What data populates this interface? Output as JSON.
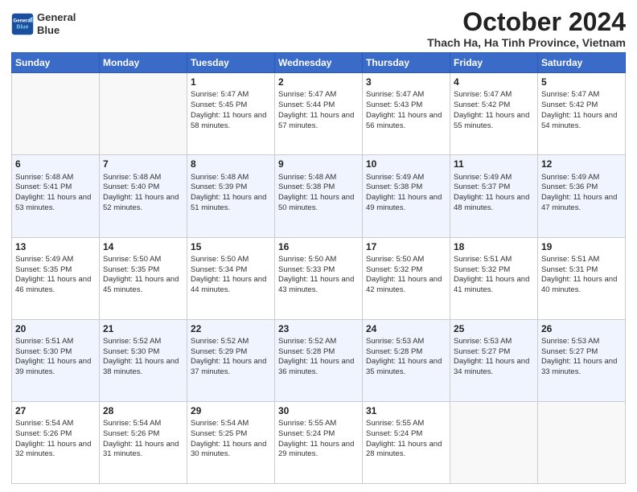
{
  "header": {
    "logo_line1": "General",
    "logo_line2": "Blue",
    "month": "October 2024",
    "location": "Thach Ha, Ha Tinh Province, Vietnam"
  },
  "days_of_week": [
    "Sunday",
    "Monday",
    "Tuesday",
    "Wednesday",
    "Thursday",
    "Friday",
    "Saturday"
  ],
  "weeks": [
    [
      {
        "day": "",
        "info": ""
      },
      {
        "day": "",
        "info": ""
      },
      {
        "day": "1",
        "info": "Sunrise: 5:47 AM\nSunset: 5:45 PM\nDaylight: 11 hours and 58 minutes."
      },
      {
        "day": "2",
        "info": "Sunrise: 5:47 AM\nSunset: 5:44 PM\nDaylight: 11 hours and 57 minutes."
      },
      {
        "day": "3",
        "info": "Sunrise: 5:47 AM\nSunset: 5:43 PM\nDaylight: 11 hours and 56 minutes."
      },
      {
        "day": "4",
        "info": "Sunrise: 5:47 AM\nSunset: 5:42 PM\nDaylight: 11 hours and 55 minutes."
      },
      {
        "day": "5",
        "info": "Sunrise: 5:47 AM\nSunset: 5:42 PM\nDaylight: 11 hours and 54 minutes."
      }
    ],
    [
      {
        "day": "6",
        "info": "Sunrise: 5:48 AM\nSunset: 5:41 PM\nDaylight: 11 hours and 53 minutes."
      },
      {
        "day": "7",
        "info": "Sunrise: 5:48 AM\nSunset: 5:40 PM\nDaylight: 11 hours and 52 minutes."
      },
      {
        "day": "8",
        "info": "Sunrise: 5:48 AM\nSunset: 5:39 PM\nDaylight: 11 hours and 51 minutes."
      },
      {
        "day": "9",
        "info": "Sunrise: 5:48 AM\nSunset: 5:38 PM\nDaylight: 11 hours and 50 minutes."
      },
      {
        "day": "10",
        "info": "Sunrise: 5:49 AM\nSunset: 5:38 PM\nDaylight: 11 hours and 49 minutes."
      },
      {
        "day": "11",
        "info": "Sunrise: 5:49 AM\nSunset: 5:37 PM\nDaylight: 11 hours and 48 minutes."
      },
      {
        "day": "12",
        "info": "Sunrise: 5:49 AM\nSunset: 5:36 PM\nDaylight: 11 hours and 47 minutes."
      }
    ],
    [
      {
        "day": "13",
        "info": "Sunrise: 5:49 AM\nSunset: 5:35 PM\nDaylight: 11 hours and 46 minutes."
      },
      {
        "day": "14",
        "info": "Sunrise: 5:50 AM\nSunset: 5:35 PM\nDaylight: 11 hours and 45 minutes."
      },
      {
        "day": "15",
        "info": "Sunrise: 5:50 AM\nSunset: 5:34 PM\nDaylight: 11 hours and 44 minutes."
      },
      {
        "day": "16",
        "info": "Sunrise: 5:50 AM\nSunset: 5:33 PM\nDaylight: 11 hours and 43 minutes."
      },
      {
        "day": "17",
        "info": "Sunrise: 5:50 AM\nSunset: 5:32 PM\nDaylight: 11 hours and 42 minutes."
      },
      {
        "day": "18",
        "info": "Sunrise: 5:51 AM\nSunset: 5:32 PM\nDaylight: 11 hours and 41 minutes."
      },
      {
        "day": "19",
        "info": "Sunrise: 5:51 AM\nSunset: 5:31 PM\nDaylight: 11 hours and 40 minutes."
      }
    ],
    [
      {
        "day": "20",
        "info": "Sunrise: 5:51 AM\nSunset: 5:30 PM\nDaylight: 11 hours and 39 minutes."
      },
      {
        "day": "21",
        "info": "Sunrise: 5:52 AM\nSunset: 5:30 PM\nDaylight: 11 hours and 38 minutes."
      },
      {
        "day": "22",
        "info": "Sunrise: 5:52 AM\nSunset: 5:29 PM\nDaylight: 11 hours and 37 minutes."
      },
      {
        "day": "23",
        "info": "Sunrise: 5:52 AM\nSunset: 5:28 PM\nDaylight: 11 hours and 36 minutes."
      },
      {
        "day": "24",
        "info": "Sunrise: 5:53 AM\nSunset: 5:28 PM\nDaylight: 11 hours and 35 minutes."
      },
      {
        "day": "25",
        "info": "Sunrise: 5:53 AM\nSunset: 5:27 PM\nDaylight: 11 hours and 34 minutes."
      },
      {
        "day": "26",
        "info": "Sunrise: 5:53 AM\nSunset: 5:27 PM\nDaylight: 11 hours and 33 minutes."
      }
    ],
    [
      {
        "day": "27",
        "info": "Sunrise: 5:54 AM\nSunset: 5:26 PM\nDaylight: 11 hours and 32 minutes."
      },
      {
        "day": "28",
        "info": "Sunrise: 5:54 AM\nSunset: 5:26 PM\nDaylight: 11 hours and 31 minutes."
      },
      {
        "day": "29",
        "info": "Sunrise: 5:54 AM\nSunset: 5:25 PM\nDaylight: 11 hours and 30 minutes."
      },
      {
        "day": "30",
        "info": "Sunrise: 5:55 AM\nSunset: 5:24 PM\nDaylight: 11 hours and 29 minutes."
      },
      {
        "day": "31",
        "info": "Sunrise: 5:55 AM\nSunset: 5:24 PM\nDaylight: 11 hours and 28 minutes."
      },
      {
        "day": "",
        "info": ""
      },
      {
        "day": "",
        "info": ""
      }
    ]
  ]
}
